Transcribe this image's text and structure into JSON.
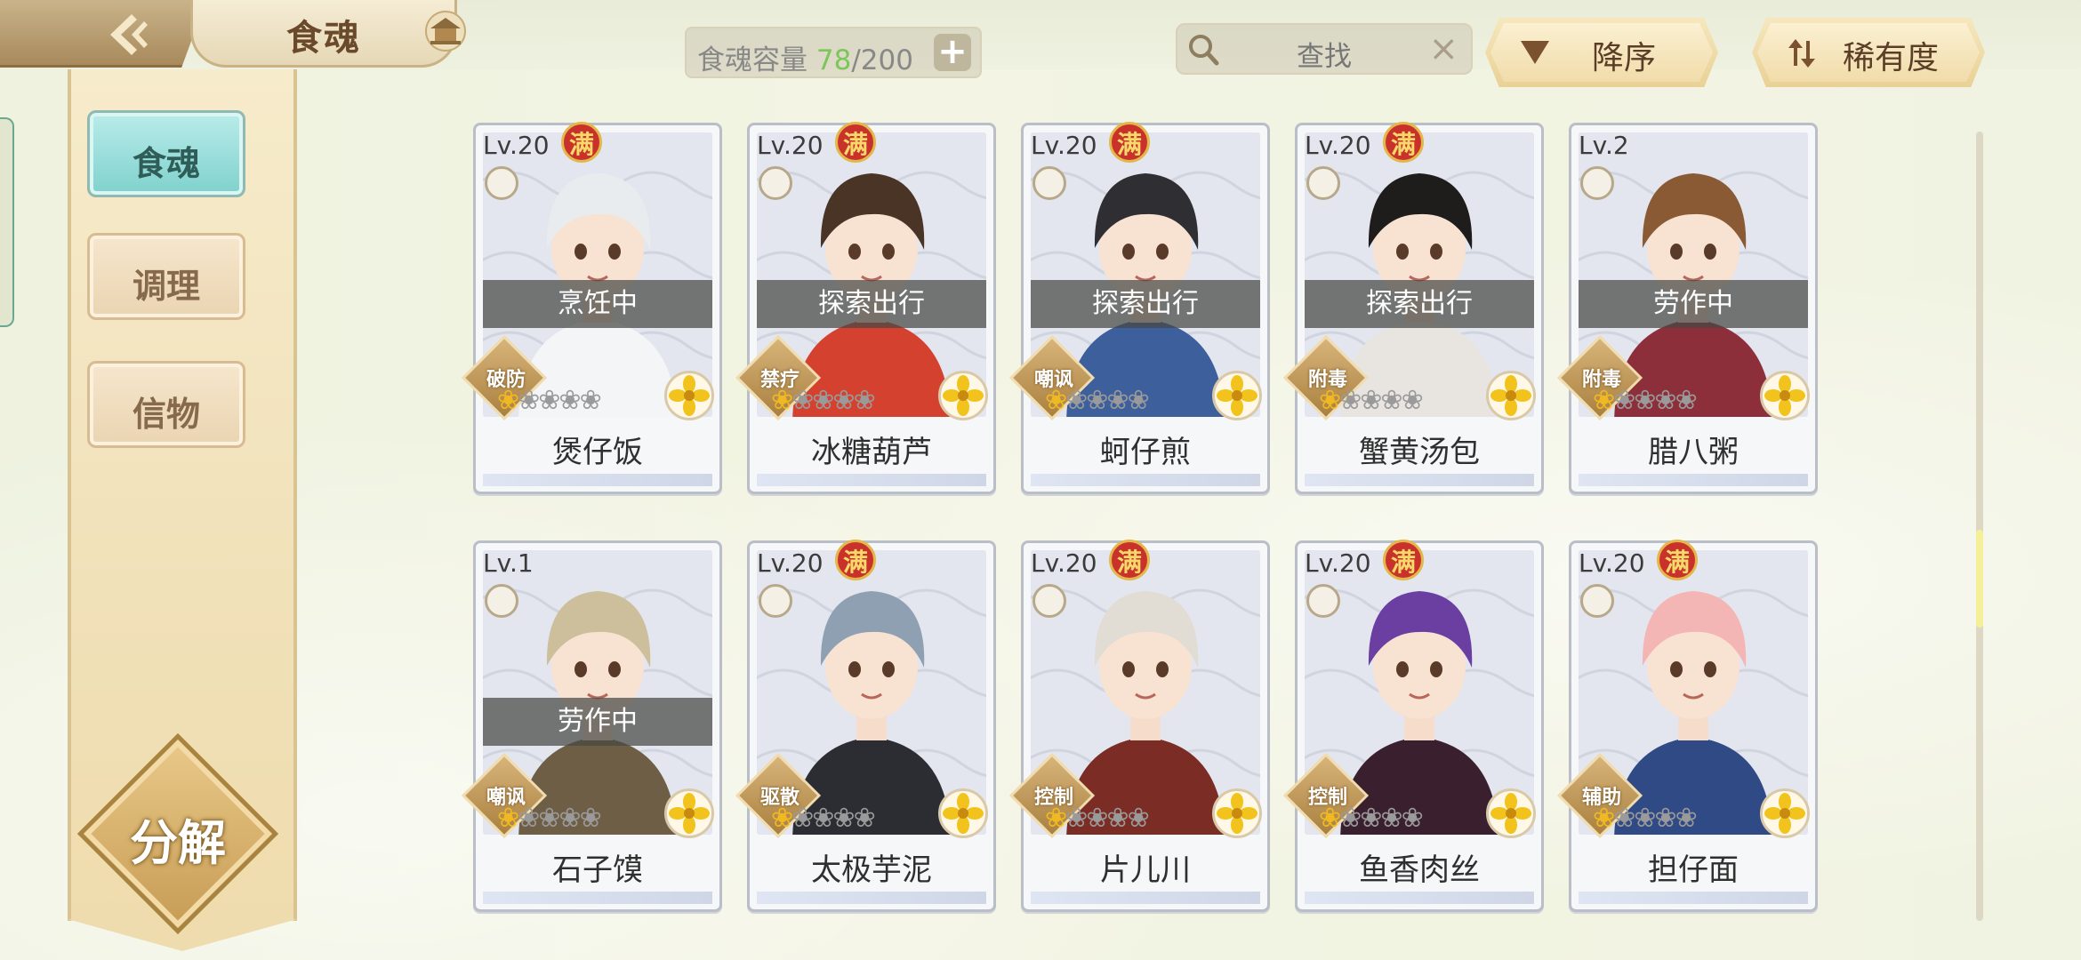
{
  "header": {
    "title": "食魂",
    "capacity_label": "食魂容量",
    "capacity_current": "78",
    "capacity_total": "/200",
    "capacity_plus": "+",
    "search_placeholder": "查找",
    "search_clear": "×",
    "sort_order_label": "降序",
    "sort_key_label": "稀有度"
  },
  "sidebar": {
    "tabs": [
      {
        "label": "食魂",
        "active": true
      },
      {
        "label": "调理",
        "active": false
      },
      {
        "label": "信物",
        "active": false
      }
    ],
    "decompose_label": "分解"
  },
  "colors": {
    "accent_teal": "#7fd1cd",
    "gold": "#e9d196",
    "max_badge_red": "#c9322a",
    "capacity_green": "#7cc65a"
  },
  "cards": [
    {
      "level": "Lv.20",
      "max_badge": "满",
      "status": "烹饪中",
      "role": "破防",
      "name": "煲仔饭",
      "lit_flames": 1,
      "total_flames": 5,
      "hair": "#e9ecef",
      "outfit": "#f3f5f7"
    },
    {
      "level": "Lv.20",
      "max_badge": "满",
      "status": "探索出行",
      "role": "禁疗",
      "name": "冰糖葫芦",
      "lit_flames": 1,
      "total_flames": 5,
      "hair": "#4a3426",
      "outfit": "#d4412f"
    },
    {
      "level": "Lv.20",
      "max_badge": "满",
      "status": "探索出行",
      "role": "嘲讽",
      "name": "蚵仔煎",
      "lit_flames": 1,
      "total_flames": 5,
      "hair": "#2f2f33",
      "outfit": "#3d5f9c"
    },
    {
      "level": "Lv.20",
      "max_badge": "满",
      "status": "探索出行",
      "role": "附毒",
      "name": "蟹黄汤包",
      "lit_flames": 1,
      "total_flames": 5,
      "hair": "#1f1c1c",
      "outfit": "#e8e4e0"
    },
    {
      "level": "Lv.2",
      "max_badge": "",
      "status": "劳作中",
      "role": "附毒",
      "name": "腊八粥",
      "lit_flames": 1,
      "total_flames": 5,
      "hair": "#8a5a34",
      "outfit": "#8c2f3a"
    },
    {
      "level": "Lv.1",
      "max_badge": "",
      "status": "劳作中",
      "role": "嘲讽",
      "name": "石子馍",
      "lit_flames": 1,
      "total_flames": 5,
      "hair": "#cdbf9c",
      "outfit": "#6e5e46"
    },
    {
      "level": "Lv.20",
      "max_badge": "满",
      "status": "",
      "role": "驱散",
      "name": "太极芋泥",
      "lit_flames": 1,
      "total_flames": 5,
      "hair": "#8fa0b2",
      "outfit": "#2b2d33"
    },
    {
      "level": "Lv.20",
      "max_badge": "满",
      "status": "",
      "role": "控制",
      "name": "片儿川",
      "lit_flames": 1,
      "total_flames": 5,
      "hair": "#e1dcd4",
      "outfit": "#7b2d25"
    },
    {
      "level": "Lv.20",
      "max_badge": "满",
      "status": "",
      "role": "控制",
      "name": "鱼香肉丝",
      "lit_flames": 1,
      "total_flames": 5,
      "hair": "#6b3fa2",
      "outfit": "#3a1f2e"
    },
    {
      "level": "Lv.20",
      "max_badge": "满",
      "status": "",
      "role": "辅助",
      "name": "担仔面",
      "lit_flames": 1,
      "total_flames": 5,
      "hair": "#f4b6b4",
      "outfit": "#2f4a84"
    }
  ]
}
